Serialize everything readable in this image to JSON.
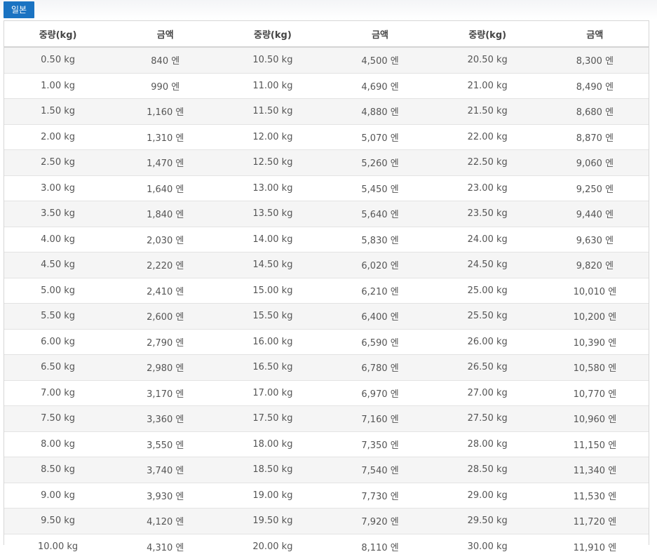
{
  "tab": {
    "label": "일본"
  },
  "table": {
    "headers": [
      "중량(kg)",
      "금액",
      "중량(kg)",
      "금액",
      "중량(kg)",
      "금액"
    ],
    "rows": [
      [
        "0.50 kg",
        "840 엔",
        "10.50 kg",
        "4,500 엔",
        "20.50 kg",
        "8,300 엔"
      ],
      [
        "1.00 kg",
        "990 엔",
        "11.00 kg",
        "4,690 엔",
        "21.00 kg",
        "8,490 엔"
      ],
      [
        "1.50 kg",
        "1,160 엔",
        "11.50 kg",
        "4,880 엔",
        "21.50 kg",
        "8,680 엔"
      ],
      [
        "2.00 kg",
        "1,310 엔",
        "12.00 kg",
        "5,070 엔",
        "22.00 kg",
        "8,870 엔"
      ],
      [
        "2.50 kg",
        "1,470 엔",
        "12.50 kg",
        "5,260 엔",
        "22.50 kg",
        "9,060 엔"
      ],
      [
        "3.00 kg",
        "1,640 엔",
        "13.00 kg",
        "5,450 엔",
        "23.00 kg",
        "9,250 엔"
      ],
      [
        "3.50 kg",
        "1,840 엔",
        "13.50 kg",
        "5,640 엔",
        "23.50 kg",
        "9,440 엔"
      ],
      [
        "4.00 kg",
        "2,030 엔",
        "14.00 kg",
        "5,830 엔",
        "24.00 kg",
        "9,630 엔"
      ],
      [
        "4.50 kg",
        "2,220 엔",
        "14.50 kg",
        "6,020 엔",
        "24.50 kg",
        "9,820 엔"
      ],
      [
        "5.00 kg",
        "2,410 엔",
        "15.00 kg",
        "6,210 엔",
        "25.00 kg",
        "10,010 엔"
      ],
      [
        "5.50 kg",
        "2,600 엔",
        "15.50 kg",
        "6,400 엔",
        "25.50 kg",
        "10,200 엔"
      ],
      [
        "6.00 kg",
        "2,790 엔",
        "16.00 kg",
        "6,590 엔",
        "26.00 kg",
        "10,390 엔"
      ],
      [
        "6.50 kg",
        "2,980 엔",
        "16.50 kg",
        "6,780 엔",
        "26.50 kg",
        "10,580 엔"
      ],
      [
        "7.00 kg",
        "3,170 엔",
        "17.00 kg",
        "6,970 엔",
        "27.00 kg",
        "10,770 엔"
      ],
      [
        "7.50 kg",
        "3,360 엔",
        "17.50 kg",
        "7,160 엔",
        "27.50 kg",
        "10,960 엔"
      ],
      [
        "8.00 kg",
        "3,550 엔",
        "18.00 kg",
        "7,350 엔",
        "28.00 kg",
        "11,150 엔"
      ],
      [
        "8.50 kg",
        "3,740 엔",
        "18.50 kg",
        "7,540 엔",
        "28.50 kg",
        "11,340 엔"
      ],
      [
        "9.00 kg",
        "3,930 엔",
        "19.00 kg",
        "7,730 엔",
        "29.00 kg",
        "11,530 엔"
      ],
      [
        "9.50 kg",
        "4,120 엔",
        "19.50 kg",
        "7,920 엔",
        "29.50 kg",
        "11,720 엔"
      ],
      [
        "10.00 kg",
        "4,310 엔",
        "20.00 kg",
        "8,110 엔",
        "30.00 kg",
        "11,910 엔"
      ]
    ]
  },
  "colors": {
    "tab_bg": "#1a73c2",
    "tab_text": "#ffffff",
    "row_stripe": "#f5f5f5",
    "border": "#d6d6d6",
    "text": "#555555"
  }
}
